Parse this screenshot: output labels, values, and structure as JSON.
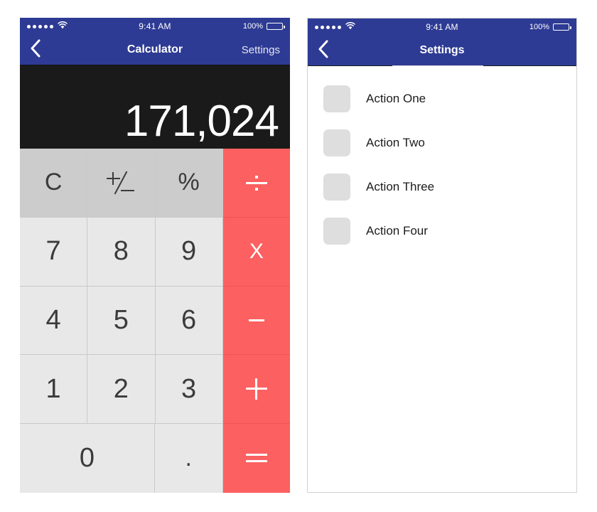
{
  "status_bar": {
    "signal_dots": 5,
    "wifi_icon": "wifi-icon",
    "time": "9:41 AM",
    "battery_percent": "100%",
    "battery_icon": "battery-full-icon"
  },
  "calculator": {
    "nav": {
      "back_icon": "chevron-left-icon",
      "title": "Calculator",
      "action_label": "Settings"
    },
    "display": {
      "value": "171,024"
    },
    "keys": [
      [
        {
          "label": "C",
          "name": "clear",
          "type": "func"
        },
        {
          "label": "+/–",
          "name": "plus-minus",
          "type": "func",
          "glyph": "plus-minus"
        },
        {
          "label": "%",
          "name": "percent",
          "type": "func"
        },
        {
          "label": "÷",
          "name": "divide",
          "type": "op",
          "glyph": "divide"
        }
      ],
      [
        {
          "label": "7",
          "name": "digit-7",
          "type": "digit"
        },
        {
          "label": "8",
          "name": "digit-8",
          "type": "digit"
        },
        {
          "label": "9",
          "name": "digit-9",
          "type": "digit"
        },
        {
          "label": "X",
          "name": "multiply",
          "type": "op",
          "glyph": "multiply"
        }
      ],
      [
        {
          "label": "4",
          "name": "digit-4",
          "type": "digit"
        },
        {
          "label": "5",
          "name": "digit-5",
          "type": "digit"
        },
        {
          "label": "6",
          "name": "digit-6",
          "type": "digit"
        },
        {
          "label": "-",
          "name": "subtract",
          "type": "op",
          "glyph": "minus"
        }
      ],
      [
        {
          "label": "1",
          "name": "digit-1",
          "type": "digit"
        },
        {
          "label": "2",
          "name": "digit-2",
          "type": "digit"
        },
        {
          "label": "3",
          "name": "digit-3",
          "type": "digit"
        },
        {
          "label": "+",
          "name": "add",
          "type": "op",
          "glyph": "plus"
        }
      ],
      [
        {
          "label": "0",
          "name": "digit-0",
          "type": "digit",
          "wide": true
        },
        {
          "label": ".",
          "name": "decimal-point",
          "type": "dot"
        },
        {
          "label": "=",
          "name": "equals",
          "type": "op",
          "glyph": "equals"
        }
      ]
    ]
  },
  "settings": {
    "nav": {
      "back_icon": "chevron-left-icon",
      "title": "Settings"
    },
    "items": [
      {
        "label": "Action One",
        "icon": "placeholder-icon"
      },
      {
        "label": "Action Two",
        "icon": "placeholder-icon"
      },
      {
        "label": "Action Three",
        "icon": "placeholder-icon"
      },
      {
        "label": "Action Four",
        "icon": "placeholder-icon"
      }
    ]
  },
  "colors": {
    "navbar_blue": "#2e3b94",
    "operator_red": "#fc6060",
    "display_black": "#1a1a1a",
    "function_key_gray": "#cccccc",
    "digit_key_gray": "#e8e8e8",
    "list_icon_gray": "#dedede"
  }
}
